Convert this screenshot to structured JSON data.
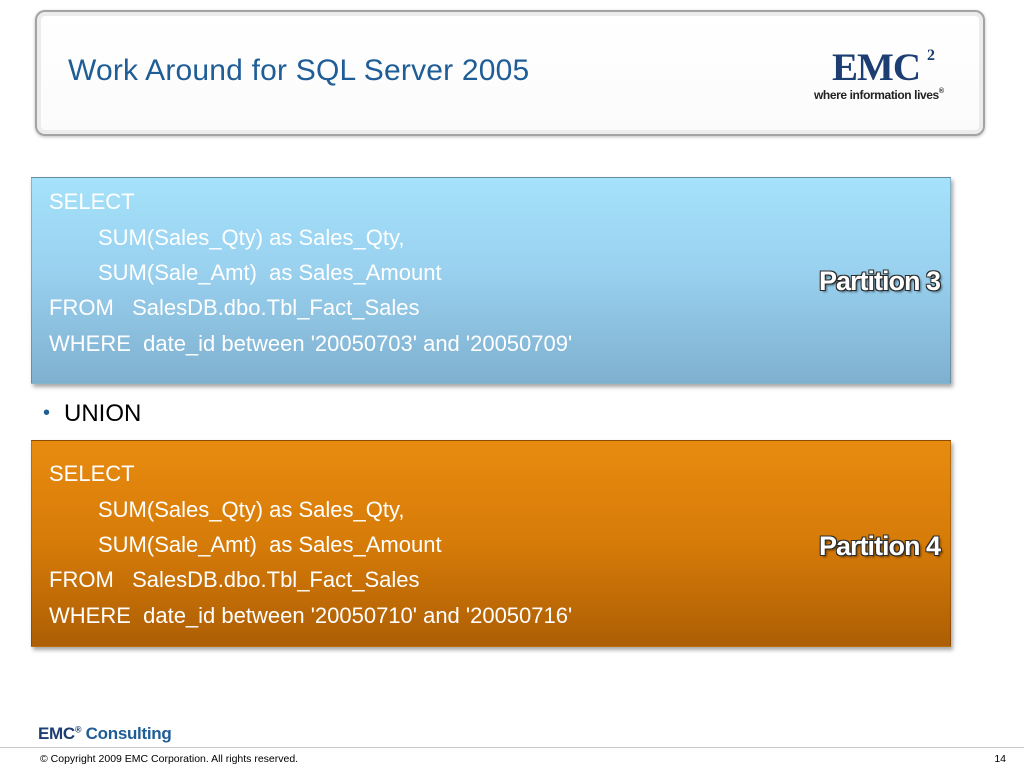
{
  "header": {
    "title": "Work Around for SQL Server 2005",
    "logo": {
      "word": "EMC",
      "superscript": "2",
      "tagline": "where information lives",
      "registered": "®"
    }
  },
  "blocks": [
    {
      "lines": [
        "SELECT",
        "SUM(Sales_Qty) as Sales_Qty,",
        "SUM(Sale_Amt)  as Sales_Amount",
        "FROM   SalesDB.dbo.Tbl_Fact_Sales",
        "WHERE  date_id between '20050703' and '20050709'"
      ],
      "label": "Partition 3",
      "color": "#99d1ef"
    },
    {
      "lines": [
        "SELECT",
        "SUM(Sales_Qty) as Sales_Qty,",
        "SUM(Sale_Amt)  as Sales_Amount",
        "FROM   SalesDB.dbo.Tbl_Fact_Sales",
        "WHERE  date_id between '20050710' and '20050716'"
      ],
      "label": "Partition 4",
      "color": "#d67b08"
    }
  ],
  "bullet": {
    "symbol": "•",
    "text": "UNION"
  },
  "footer": {
    "brand": "EMC",
    "brand_reg": "®",
    "brand_sub": "Consulting",
    "copyright": "© Copyright 2009 EMC Corporation. All rights reserved.",
    "page_number": "14"
  },
  "colors": {
    "title": "#1f5d96",
    "logo": "#1d3e73"
  }
}
